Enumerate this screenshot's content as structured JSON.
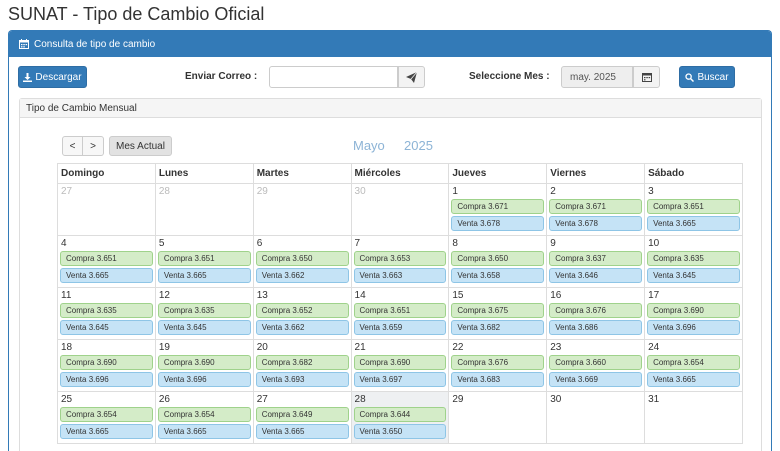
{
  "page": {
    "title": "SUNAT - Tipo de Cambio Oficial"
  },
  "panel": {
    "heading": "Consulta de tipo de cambio"
  },
  "toolbar": {
    "download_label": "Descargar",
    "email_label": "Enviar Correo :",
    "email_value": "",
    "month_label": "Seleccione Mes :",
    "month_value": "may. 2025",
    "search_label": "Buscar"
  },
  "monthly": {
    "heading": "Tipo de Cambio Mensual"
  },
  "calendar": {
    "prev_label": "<",
    "next_label": ">",
    "current_label": "Mes Actual",
    "month_name": "Mayo",
    "year": "2025",
    "weekdays": [
      "Domingo",
      "Lunes",
      "Martes",
      "Miércoles",
      "Jueves",
      "Viernes",
      "Sábado"
    ],
    "buy_prefix": "Compra",
    "sell_prefix": "Venta",
    "weeks": [
      [
        {
          "day": "27",
          "other": true
        },
        {
          "day": "28",
          "other": true
        },
        {
          "day": "29",
          "other": true
        },
        {
          "day": "30",
          "other": true
        },
        {
          "day": "1",
          "buy": "3.671",
          "sell": "3.678"
        },
        {
          "day": "2",
          "buy": "3.671",
          "sell": "3.678"
        },
        {
          "day": "3",
          "buy": "3.651",
          "sell": "3.665"
        }
      ],
      [
        {
          "day": "4",
          "buy": "3.651",
          "sell": "3.665"
        },
        {
          "day": "5",
          "buy": "3.651",
          "sell": "3.665"
        },
        {
          "day": "6",
          "buy": "3.650",
          "sell": "3.662"
        },
        {
          "day": "7",
          "buy": "3.653",
          "sell": "3.663"
        },
        {
          "day": "8",
          "buy": "3.650",
          "sell": "3.658"
        },
        {
          "day": "9",
          "buy": "3.637",
          "sell": "3.646"
        },
        {
          "day": "10",
          "buy": "3.635",
          "sell": "3.645"
        }
      ],
      [
        {
          "day": "11",
          "buy": "3.635",
          "sell": "3.645"
        },
        {
          "day": "12",
          "buy": "3.635",
          "sell": "3.645"
        },
        {
          "day": "13",
          "buy": "3.652",
          "sell": "3.662"
        },
        {
          "day": "14",
          "buy": "3.651",
          "sell": "3.659"
        },
        {
          "day": "15",
          "buy": "3.675",
          "sell": "3.682"
        },
        {
          "day": "16",
          "buy": "3.676",
          "sell": "3.686"
        },
        {
          "day": "17",
          "buy": "3.690",
          "sell": "3.696"
        }
      ],
      [
        {
          "day": "18",
          "buy": "3.690",
          "sell": "3.696"
        },
        {
          "day": "19",
          "buy": "3.690",
          "sell": "3.696"
        },
        {
          "day": "20",
          "buy": "3.682",
          "sell": "3.693"
        },
        {
          "day": "21",
          "buy": "3.690",
          "sell": "3.697"
        },
        {
          "day": "22",
          "buy": "3.676",
          "sell": "3.683"
        },
        {
          "day": "23",
          "buy": "3.660",
          "sell": "3.669"
        },
        {
          "day": "24",
          "buy": "3.654",
          "sell": "3.665"
        }
      ],
      [
        {
          "day": "25",
          "buy": "3.654",
          "sell": "3.665"
        },
        {
          "day": "26",
          "buy": "3.654",
          "sell": "3.665"
        },
        {
          "day": "27",
          "buy": "3.649",
          "sell": "3.665"
        },
        {
          "day": "28",
          "buy": "3.644",
          "sell": "3.650",
          "today": true
        },
        {
          "day": "29"
        },
        {
          "day": "30"
        },
        {
          "day": "31"
        }
      ]
    ]
  },
  "colors": {
    "primary": "#337ab7",
    "buy_bg": "#d4ecc8",
    "sell_bg": "#c5e3f6",
    "today_bg": "#eef0f2"
  }
}
